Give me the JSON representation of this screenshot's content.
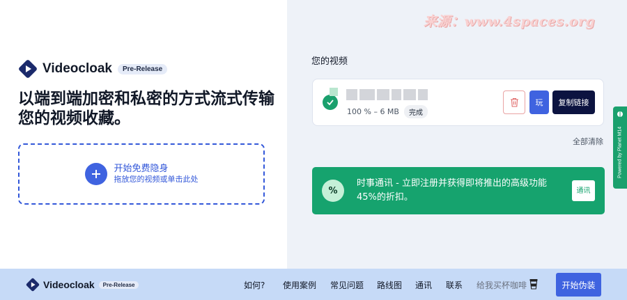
{
  "watermark": "来源：www.4spaces.org",
  "brand": {
    "name": "Videocloak",
    "badge": "Pre-Release"
  },
  "hero": {
    "headline": "以端到端加密和私密的方式流式传输您的视频收藏。"
  },
  "dropzone": {
    "title": "开始免费隐身",
    "subtitle": "拖放您的视频或单击此处"
  },
  "videos": {
    "section_title": "您的视频",
    "items": [
      {
        "progress_text": "100 % – 6 MB",
        "status": "完成",
        "play_label": "玩",
        "copy_label": "复制链接"
      }
    ],
    "clear_all": "全部清除"
  },
  "newsletter": {
    "icon_text": "%",
    "text": "时事通讯 - 立即注册并获得即将推出的高级功能 45%的折扣。",
    "button": "通讯"
  },
  "side_tab": {
    "text": "Powered by Planet M14"
  },
  "footer": {
    "nav": [
      "如何?",
      "使用案例",
      "常见问题",
      "路线图",
      "通讯",
      "联系",
      "给我买杯咖啡"
    ],
    "cta": "开始伪装"
  },
  "colors": {
    "primary": "#3f63e0",
    "dark": "#0c1340",
    "success": "#16a36e",
    "footer_bg": "#c6daf7",
    "right_bg": "#eef2f8"
  },
  "icons": [
    "logo-play-icon",
    "plus-icon",
    "check-icon",
    "trash-icon",
    "percent-icon",
    "coffee-cup-icon",
    "side-tab-icon"
  ]
}
